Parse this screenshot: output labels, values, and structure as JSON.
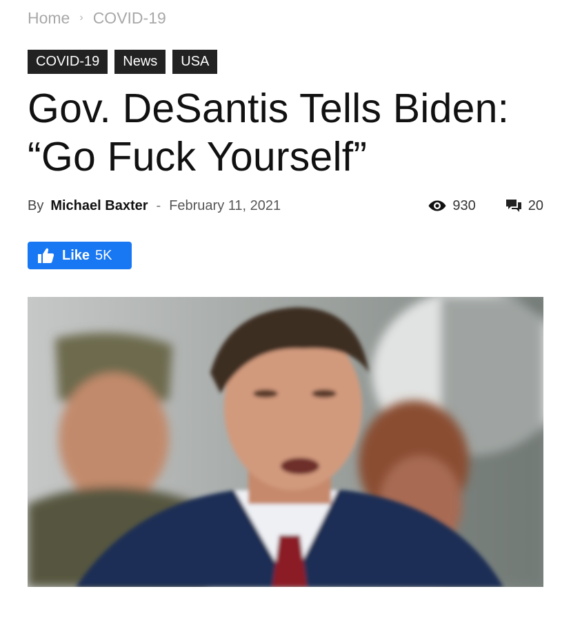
{
  "breadcrumb": {
    "home": "Home",
    "separator": "›",
    "current": "COVID-19"
  },
  "tags": [
    "COVID-19",
    "News",
    "USA"
  ],
  "headline": {
    "line1": "Gov. DeSantis Tells Biden:",
    "line2": "“Go Fuck Yourself”"
  },
  "meta": {
    "by": "By",
    "author": "Michael Baxter",
    "dash": "-",
    "date": "February 11, 2021",
    "views": "930",
    "comments": "20",
    "views_icon": "eye-icon",
    "comments_icon": "comments-icon"
  },
  "like": {
    "label": "Like",
    "count": "5K",
    "icon": "thumbs-up-icon",
    "color": "#1877f2"
  },
  "colors": {
    "tag_bg": "#222222",
    "breadcrumb": "#a8a8a8",
    "text": "#111111"
  }
}
